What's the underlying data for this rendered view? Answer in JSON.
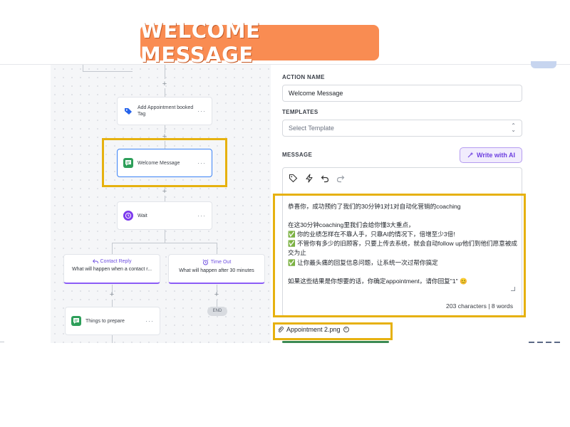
{
  "banner": {
    "title": "WELCOME MESSAGE"
  },
  "workflow": {
    "tag_node": {
      "label": "Add Appointment booked Tag",
      "icon": "tag-icon"
    },
    "welcome_node": {
      "label": "Welcome Message",
      "icon": "chat-icon"
    },
    "wait_node": {
      "label": "Wait",
      "icon": "clock-icon"
    },
    "contact_reply": {
      "title": "Contact Reply",
      "subtitle": "What will happen when a contact r..."
    },
    "time_out": {
      "title": "Time Out",
      "subtitle": "What will happen after 30 minutes"
    },
    "prepare_node": {
      "label": "Things to prepare",
      "icon": "chat-icon"
    },
    "end_label": "END",
    "menu_glyph": "···"
  },
  "panel": {
    "action_name_label": "ACTION NAME",
    "action_name_value": "Welcome Message",
    "templates_label": "TEMPLATES",
    "templates_placeholder": "Select Template",
    "message_label": "MESSAGE",
    "write_ai_label": "Write with AI",
    "message_lines": [
      "恭喜你，成功预约了我们的30分钟1对1对自动化营销的coaching",
      "",
      "在这30分钟coaching里我们会给你懂3大重点，",
      "✅ 你的业绩怎样在不靠人手，只靠AI的情况下，倍增至少3倍!",
      "✅ 不管你有多少的旧顾客，只要上传去系统，就会自动follow up他们到他们愿意被成交为止",
      "✅ 让你最头痛的回复信息问题，让系统一次过帮你搞定",
      "",
      "如果这些结果是你想要的话，你确定appointment，请你回复\"1\" 😊"
    ],
    "counter": "203 characters | 8 words",
    "attachment": "Appointment 2.png"
  },
  "colors": {
    "banner": "#f98c52",
    "highlight": "#e6b10f",
    "accent_purple": "#8b5cf6",
    "chat_green": "#2e9f5a",
    "tag_blue": "#2563eb"
  }
}
